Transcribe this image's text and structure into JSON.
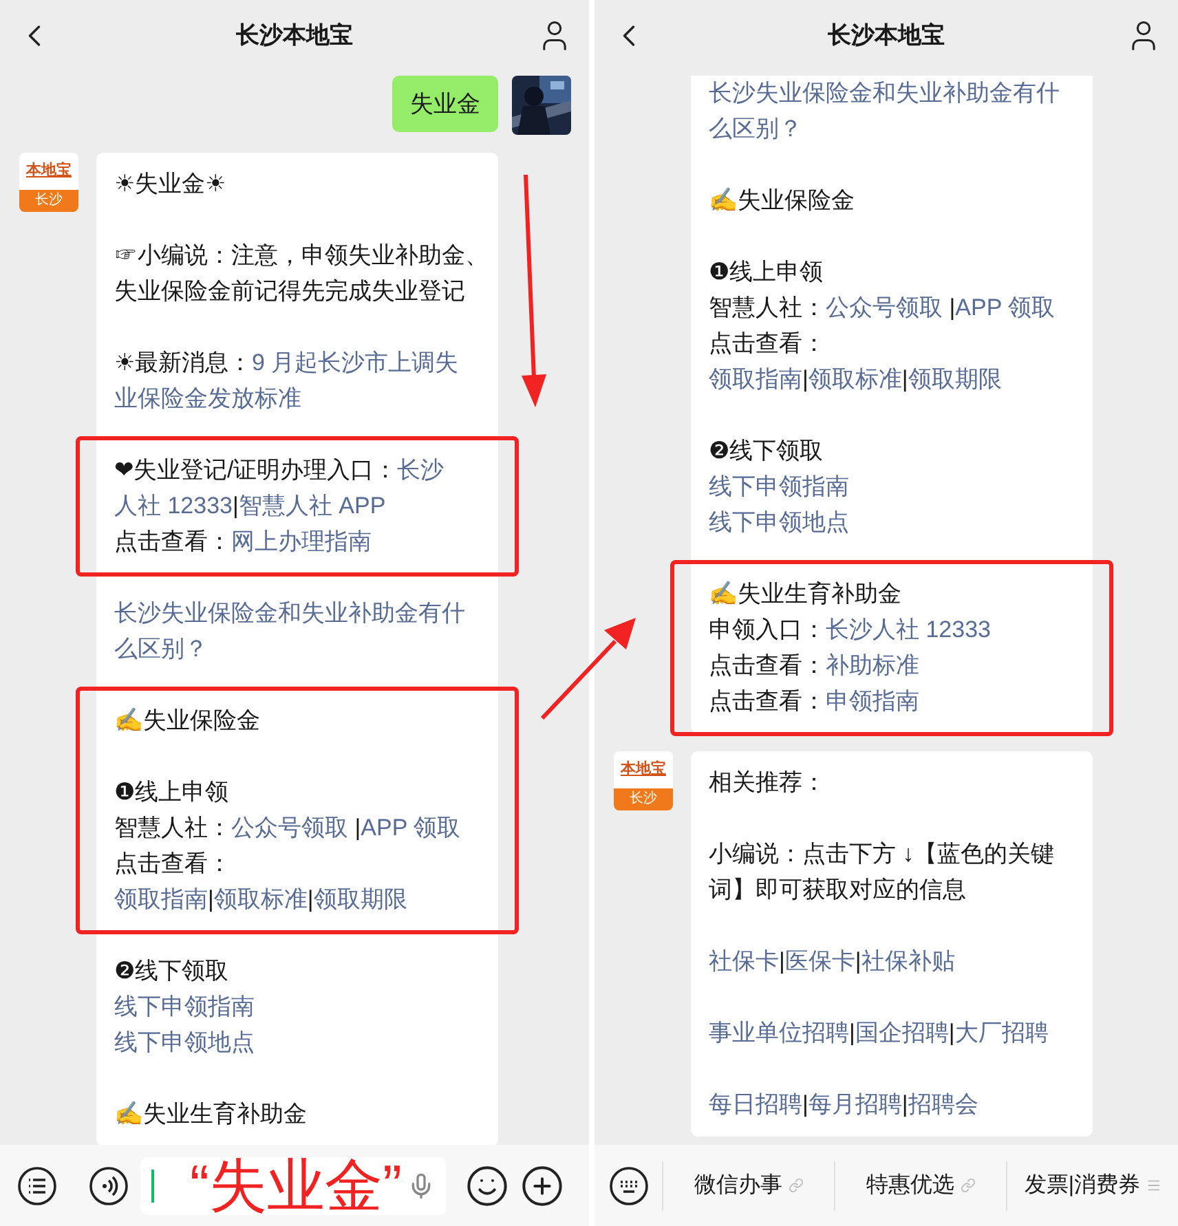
{
  "phones": [
    {
      "header": {
        "title": "长沙本地宝"
      },
      "messages": [
        {
          "kind": "outgoing",
          "text": "失业金"
        },
        {
          "kind": "incoming",
          "avatar": {
            "logo": "本地宝",
            "city": "长沙"
          },
          "blocks": [
            {
              "highlighted": false,
              "paragraphs": [
                {
                  "lines": [
                    [
                      {
                        "text": "☀失业金☀",
                        "link": false
                      }
                    ]
                  ]
                },
                {
                  "lines": [
                    [
                      {
                        "text": "☞小编说：注意，申领失业补助金、",
                        "link": false
                      }
                    ],
                    [
                      {
                        "text": "失业保险金前记得先完成失业登记",
                        "link": false
                      }
                    ]
                  ]
                },
                {
                  "lines": [
                    [
                      {
                        "text": "☀最新消息：",
                        "link": false
                      },
                      {
                        "text": "9 月起长沙市上调失",
                        "link": true
                      }
                    ],
                    [
                      {
                        "text": "业保险金发放标准",
                        "link": true
                      }
                    ]
                  ]
                }
              ]
            },
            {
              "highlighted": true,
              "paragraphs": [
                {
                  "lines": [
                    [
                      {
                        "text": "❤失业登记/证明办理入口：",
                        "link": false
                      },
                      {
                        "text": "长沙",
                        "link": true
                      }
                    ],
                    [
                      {
                        "text": "人社 12333",
                        "link": true
                      },
                      {
                        "text": "|",
                        "link": false
                      },
                      {
                        "text": "智慧人社 APP",
                        "link": true
                      }
                    ],
                    [
                      {
                        "text": "点击查看：",
                        "link": false
                      },
                      {
                        "text": "网上办理指南",
                        "link": true
                      }
                    ]
                  ]
                }
              ]
            },
            {
              "highlighted": false,
              "paragraphs": [
                {
                  "lines": [
                    [
                      {
                        "text": "长沙失业保险金和失业补助金有什",
                        "link": true
                      }
                    ],
                    [
                      {
                        "text": "么区别？",
                        "link": true
                      }
                    ]
                  ]
                }
              ]
            },
            {
              "highlighted": true,
              "paragraphs": [
                {
                  "lines": [
                    [
                      {
                        "text": "✍失业保险金",
                        "link": false
                      }
                    ]
                  ]
                },
                {
                  "lines": [
                    [
                      {
                        "text": "❶线上申领",
                        "link": false
                      }
                    ],
                    [
                      {
                        "text": "智慧人社：",
                        "link": false
                      },
                      {
                        "text": "公众号领取 ",
                        "link": true
                      },
                      {
                        "text": "|",
                        "link": false
                      },
                      {
                        "text": "APP 领取",
                        "link": true
                      }
                    ],
                    [
                      {
                        "text": "点击查看：",
                        "link": false
                      }
                    ],
                    [
                      {
                        "text": "领取指南",
                        "link": true
                      },
                      {
                        "text": "|",
                        "link": false
                      },
                      {
                        "text": "领取标准",
                        "link": true
                      },
                      {
                        "text": "|",
                        "link": false
                      },
                      {
                        "text": "领取期限",
                        "link": true
                      }
                    ]
                  ]
                }
              ]
            },
            {
              "highlighted": false,
              "paragraphs": [
                {
                  "lines": [
                    [
                      {
                        "text": "❷线下领取",
                        "link": false
                      }
                    ],
                    [
                      {
                        "text": "线下申领指南",
                        "link": true
                      }
                    ],
                    [
                      {
                        "text": "线下申领地点",
                        "link": true
                      }
                    ]
                  ]
                },
                {
                  "lines": [
                    [
                      {
                        "text": "✍失业生育补助金",
                        "link": false
                      }
                    ]
                  ]
                }
              ]
            }
          ]
        }
      ],
      "bottom_bar": {
        "kind": "input",
        "overlay_text": "“失业金”"
      }
    },
    {
      "header": {
        "title": "长沙本地宝"
      },
      "messages": [
        {
          "kind": "incoming",
          "blocks": [
            {
              "highlighted": false,
              "paragraphs": [
                {
                  "lines": [
                    [
                      {
                        "text": "长沙失业保险金和失业补助金有什",
                        "link": true
                      }
                    ],
                    [
                      {
                        "text": "么区别？",
                        "link": true
                      }
                    ]
                  ]
                },
                {
                  "lines": [
                    [
                      {
                        "text": "✍失业保险金",
                        "link": false
                      }
                    ]
                  ]
                },
                {
                  "lines": [
                    [
                      {
                        "text": "❶线上申领",
                        "link": false
                      }
                    ],
                    [
                      {
                        "text": "智慧人社：",
                        "link": false
                      },
                      {
                        "text": "公众号领取 ",
                        "link": true
                      },
                      {
                        "text": "|",
                        "link": false
                      },
                      {
                        "text": "APP 领取",
                        "link": true
                      }
                    ],
                    [
                      {
                        "text": "点击查看：",
                        "link": false
                      }
                    ],
                    [
                      {
                        "text": "领取指南",
                        "link": true
                      },
                      {
                        "text": "|",
                        "link": false
                      },
                      {
                        "text": "领取标准",
                        "link": true
                      },
                      {
                        "text": "|",
                        "link": false
                      },
                      {
                        "text": "领取期限",
                        "link": true
                      }
                    ]
                  ]
                },
                {
                  "lines": [
                    [
                      {
                        "text": "❷线下领取",
                        "link": false
                      }
                    ],
                    [
                      {
                        "text": "线下申领指南",
                        "link": true
                      }
                    ],
                    [
                      {
                        "text": "线下申领地点",
                        "link": true
                      }
                    ]
                  ]
                }
              ]
            },
            {
              "highlighted": true,
              "paragraphs": [
                {
                  "lines": [
                    [
                      {
                        "text": "✍失业生育补助金",
                        "link": false
                      }
                    ],
                    [
                      {
                        "text": "申领入口：",
                        "link": false
                      },
                      {
                        "text": "长沙人社 12333",
                        "link": true
                      }
                    ],
                    [
                      {
                        "text": "点击查看：",
                        "link": false
                      },
                      {
                        "text": "补助标准",
                        "link": true
                      }
                    ],
                    [
                      {
                        "text": "点击查看：",
                        "link": false
                      },
                      {
                        "text": "申领指南",
                        "link": true
                      }
                    ]
                  ]
                }
              ]
            }
          ]
        },
        {
          "kind": "incoming",
          "avatar": {
            "logo": "本地宝",
            "city": "长沙"
          },
          "blocks": [
            {
              "highlighted": false,
              "paragraphs": [
                {
                  "lines": [
                    [
                      {
                        "text": "相关推荐：",
                        "link": false
                      }
                    ]
                  ]
                },
                {
                  "lines": [
                    [
                      {
                        "text": "小编说：点击下方 ↓【蓝色的关键",
                        "link": false
                      }
                    ],
                    [
                      {
                        "text": "词】即可获取对应的信息",
                        "link": false
                      }
                    ]
                  ]
                },
                {
                  "lines": [
                    [
                      {
                        "text": "社保卡",
                        "link": true
                      },
                      {
                        "text": "|",
                        "link": false
                      },
                      {
                        "text": "医保卡",
                        "link": true
                      },
                      {
                        "text": "|",
                        "link": false
                      },
                      {
                        "text": "社保补贴",
                        "link": true
                      }
                    ]
                  ]
                },
                {
                  "lines": [
                    [
                      {
                        "text": "事业单位招聘",
                        "link": true
                      },
                      {
                        "text": "|",
                        "link": false
                      },
                      {
                        "text": "国企招聘",
                        "link": true
                      },
                      {
                        "text": "|",
                        "link": false
                      },
                      {
                        "text": "大厂招聘",
                        "link": true
                      }
                    ]
                  ]
                },
                {
                  "lines": [
                    [
                      {
                        "text": "每日招聘",
                        "link": true
                      },
                      {
                        "text": "|",
                        "link": false
                      },
                      {
                        "text": "每月招聘",
                        "link": true
                      },
                      {
                        "text": "|",
                        "link": false
                      },
                      {
                        "text": "招聘会",
                        "link": true
                      }
                    ]
                  ]
                }
              ]
            }
          ]
        }
      ],
      "bottom_bar": {
        "kind": "menu",
        "items": [
          {
            "label": "微信办事",
            "kind": "link"
          },
          {
            "label": "特惠优选",
            "kind": "link"
          },
          {
            "label": "发票|消费券",
            "kind": "submenu"
          }
        ]
      }
    }
  ]
}
